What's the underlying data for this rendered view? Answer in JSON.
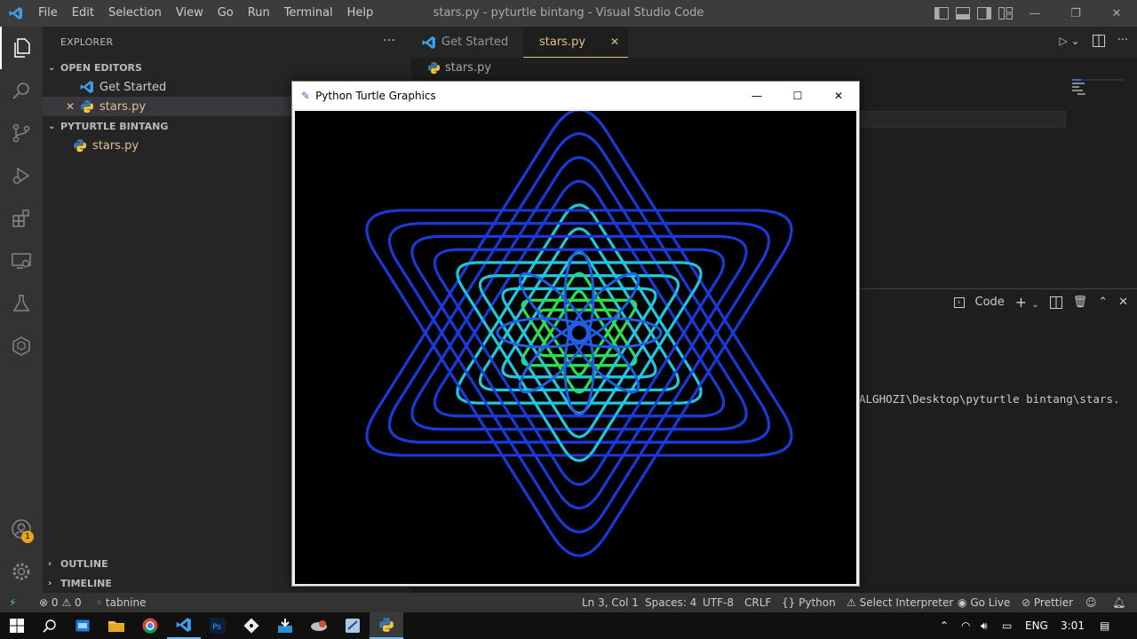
{
  "window": {
    "title": "stars.py - pyturtle bintang - Visual Studio Code",
    "menu": [
      "File",
      "Edit",
      "Selection",
      "View",
      "Go",
      "Run",
      "Terminal",
      "Help"
    ]
  },
  "sidebar": {
    "header": "EXPLORER",
    "more": "···",
    "open_editors": {
      "label": "OPEN EDITORS",
      "items": [
        {
          "label": "Get Started",
          "icon": "vscode-icon"
        },
        {
          "label": "stars.py",
          "icon": "python-icon",
          "close": "✕"
        }
      ]
    },
    "folder": {
      "label": "PYTURTLE BINTANG",
      "items": [
        {
          "label": "stars.py",
          "icon": "python-icon"
        }
      ]
    },
    "outline": "OUTLINE",
    "timeline": "TIMELINE"
  },
  "tabs": [
    {
      "label": "Get Started",
      "icon": "vscode-icon"
    },
    {
      "label": "stars.py",
      "icon": "python-icon",
      "close": "✕"
    }
  ],
  "breadcrumb": "stars.py",
  "turtle_window": {
    "title": "Python Turtle Graphics",
    "star_colors": [
      "#1a3ad8",
      "#1ec8e0",
      "#2adf50",
      "#3ef03a",
      "#1f5fe6"
    ]
  },
  "panel": {
    "shell_label": "Code",
    "terminal_line": "ALGHOZI\\Desktop\\pyturtle bintang\\stars."
  },
  "activity": {
    "badge": "1"
  },
  "statusbar": {
    "remote": "⚡",
    "errors": "0",
    "warnings": "0",
    "tabnine": "tabnine",
    "position": "Ln 3, Col 1",
    "spaces": "Spaces: 4",
    "encoding": "UTF-8",
    "eol": "CRLF",
    "language": "Python",
    "interpreter": "Select Interpreter",
    "golive": "Go Live",
    "prettier": "Prettier"
  },
  "taskbar": {
    "language": "ENG",
    "time": "3:01"
  }
}
